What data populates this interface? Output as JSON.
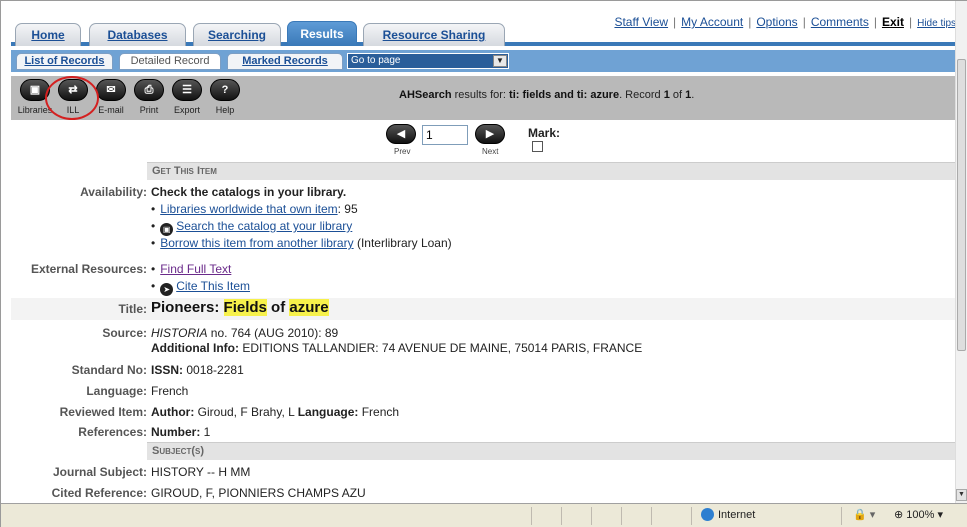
{
  "tabs": [
    {
      "label": "Home"
    },
    {
      "label": "Databases"
    },
    {
      "label": "Searching"
    },
    {
      "label": "Results"
    },
    {
      "label": "Resource Sharing"
    }
  ],
  "toplinks": {
    "staff_view": "Staff View",
    "my_account": "My Account",
    "options": "Options",
    "comments": "Comments",
    "exit": "Exit",
    "hide_tips": "Hide tips"
  },
  "subtabs": [
    {
      "label": "List of Records"
    },
    {
      "label": "Detailed Record"
    },
    {
      "label": "Marked Records"
    }
  ],
  "goto_page": "Go to page",
  "toolbar": {
    "items": [
      {
        "label": "Libraries",
        "icon": "library-icon"
      },
      {
        "label": "ILL",
        "icon": "ill-icon"
      },
      {
        "label": "E-mail",
        "icon": "email-icon"
      },
      {
        "label": "Print",
        "icon": "print-icon"
      },
      {
        "label": "Export",
        "icon": "export-icon"
      },
      {
        "label": "Help",
        "icon": "help-icon"
      }
    ],
    "results_prefix": "AHSearch",
    "results_mid": " results for: ",
    "query": "ti: fields and ti: azure",
    "record_text": ". Record ",
    "record_num": "1",
    "of_text": " of ",
    "record_total": "1",
    "end": "."
  },
  "pager": {
    "prev": "Prev",
    "next": "Next",
    "page_value": "1",
    "mark": "Mark:"
  },
  "record": {
    "get_this_item": "Get This Item",
    "availability_label": "Availability:",
    "availability_text": "Check the catalogs in your library.",
    "libraries_link": "Libraries worldwide that own item",
    "libraries_count": ": 95",
    "search_catalog": "Search the catalog at your library",
    "borrow_link": "Borrow this item from another library",
    "borrow_note": " (Interlibrary Loan)",
    "external_label": "External Resources:",
    "find_full_text": "Find Full Text",
    "cite_item": "Cite This Item",
    "title_label": "Title:",
    "title_a": "Pioneers: ",
    "title_b": "Fields",
    "title_c": " of ",
    "title_d": "azure",
    "source_label": "Source:",
    "source_journal": "HISTORIA",
    "source_rest": " no. 764 (AUG 2010): 89",
    "additional_label": "Additional Info:",
    "additional_text": " EDITIONS TALLANDIER: 74 AVENUE DE MAINE, 75014 PARIS, FRANCE",
    "standard_label": "Standard No:",
    "issn_label": "ISSN:",
    "issn_value": " 0018-2281",
    "language_label": "Language:",
    "language_value": "French",
    "reviewed_label": "Reviewed Item:",
    "author_label": "Author:",
    "author_value": " Giroud, F Brahy, L ",
    "reviewed_language_label": "Language:",
    "reviewed_language_value": " French",
    "references_label": "References:",
    "number_label": "Number:",
    "number_value": " 1",
    "subjects": "Subject(s)",
    "journal_subject_label": "Journal Subject:",
    "journal_subject_value": "HISTORY -- H MM",
    "cited_label": "Cited Reference:",
    "cited_value": "GIROUD, F, PIONNIERS CHAMPS AZU"
  },
  "statusbar": {
    "zone": "Internet",
    "zoom": "100%"
  },
  "colors": {
    "tab_active": "#3a79b8",
    "link": "#1b4f96",
    "highlight": "#f7f14b",
    "annotation_ring": "#d42020"
  }
}
